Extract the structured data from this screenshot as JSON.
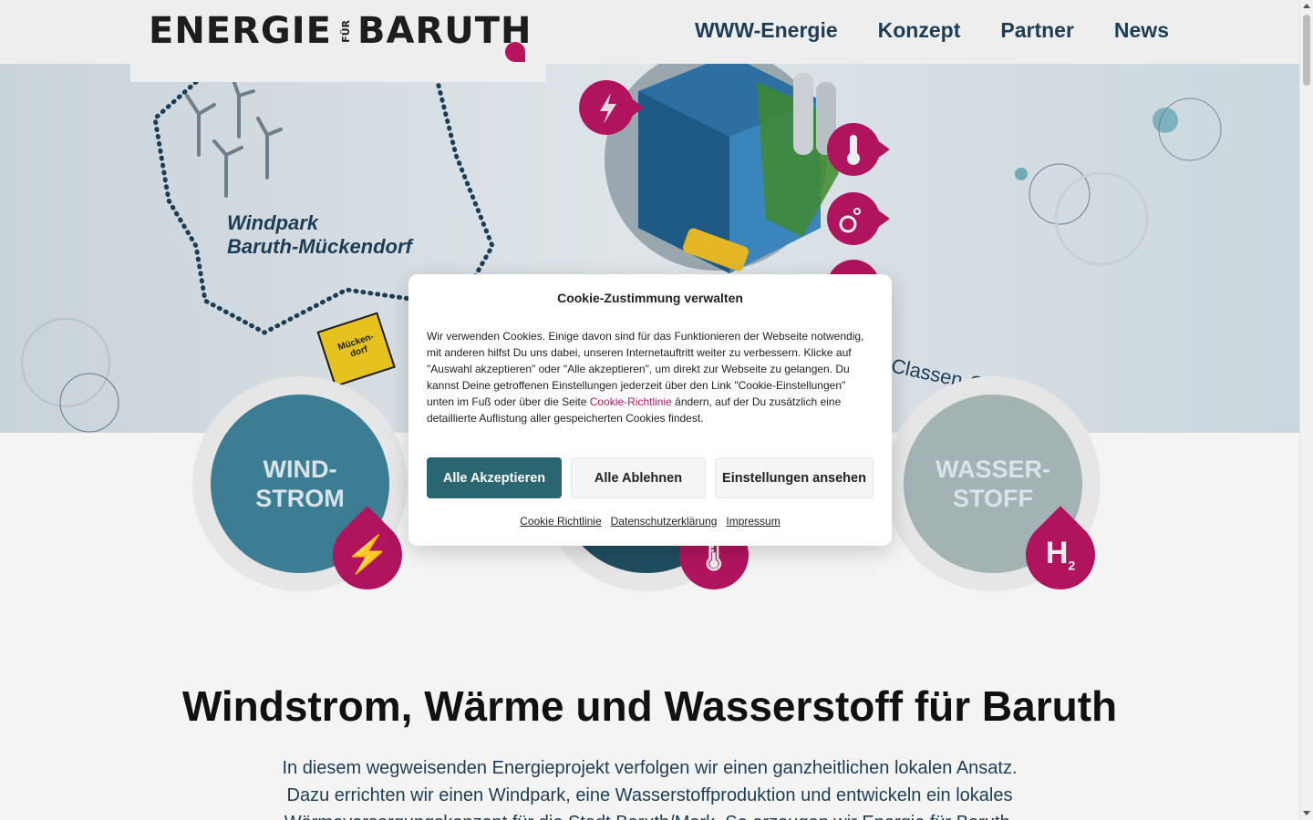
{
  "header": {
    "logo": {
      "word1": "ENERGIE",
      "fuer": "FÜR",
      "word2": "BARUTH"
    },
    "nav": [
      {
        "label": "WWW-Energie"
      },
      {
        "label": "Konzept"
      },
      {
        "label": "Partner"
      },
      {
        "label": "News"
      }
    ]
  },
  "hero": {
    "windpark_label_line1": "Windpark",
    "windpark_label_line2": "Baruth-Mückendorf",
    "sign_label": "Mücken-dorf",
    "classen_label": "Classen-Gruppe"
  },
  "cards": [
    {
      "line1": "WIND-",
      "line2": "STROM",
      "icon": "lightning-icon",
      "color": "#3c7d93"
    },
    {
      "line1": "",
      "line2": "",
      "icon": "thermometer-icon",
      "color": "#1f4d5f"
    },
    {
      "line1": "WASSER-",
      "line2": "STOFF",
      "icon": "hydrogen-icon",
      "badge": "H",
      "badge_sub": "2",
      "color": "#a3b2b3"
    }
  ],
  "main": {
    "headline": "Windstrom, Wärme und Wasserstoff für Baruth",
    "intro": "In diesem wegweisenden Energieprojekt verfolgen wir einen ganzheitlichen lokalen Ansatz. Dazu errichten wir einen Windpark, eine Wasserstoffproduktion und entwickeln ein lokales Wärmeversorgungskonzept für die Stadt Baruth/Mark. So erzeugen wir Energie für Baruth."
  },
  "cookie": {
    "title": "Cookie-Zustimmung verwalten",
    "body_before": "Wir verwenden Cookies. Einige davon sind für das Funktionieren der Webseite notwendig, mit anderen hilfst Du uns dabei, unseren Internetauftritt weiter zu verbessern. Klicke auf \"Auswahl akzeptieren\" oder \"Alle akzeptieren\", um direkt zur Webseite zu gelangen. Du kannst Deine getroffenen Einstellungen jederzeit über den Link \"Cookie-Einstellungen\" unten im Fuß oder über die Seite ",
    "body_link": "Cookie-Richtlinie",
    "body_after": " ändern, auf der Du zusätzlich eine detaillierte Auflistung aller gespeicherten Cookies findest.",
    "accept_all": "Alle Akzeptieren",
    "deny_all": "Alle Ablehnen",
    "view_settings": "Einstellungen ansehen",
    "links": {
      "cookie_policy": "Cookie Richtlinie",
      "privacy": "Datenschutzerklärung",
      "imprint": "Impressum"
    },
    "accent_color": "#2a6671",
    "link_color": "#b5145f"
  },
  "colors": {
    "brand_magenta": "#b0145e",
    "nav_text": "#1d3c55"
  }
}
